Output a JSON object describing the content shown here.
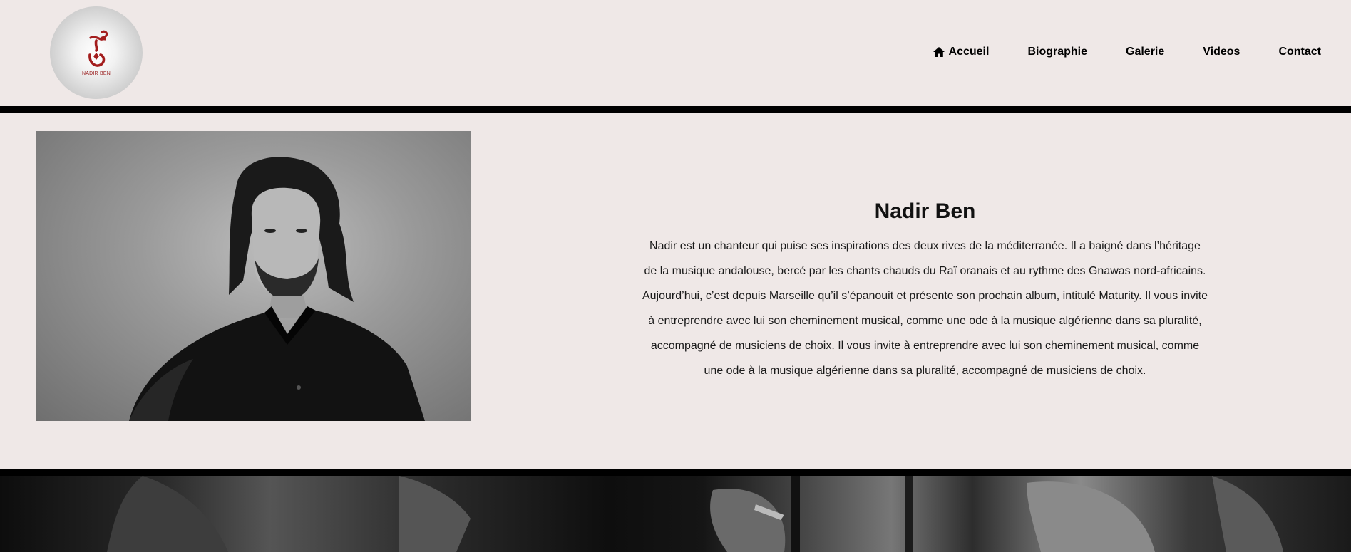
{
  "logo": {
    "text": "NADIR BEN",
    "icon": "nadir-ben-calligraphy-logo",
    "accent": "#a31d1d"
  },
  "nav": {
    "items": [
      {
        "label": "Accueil",
        "icon": "home-icon"
      },
      {
        "label": "Biographie"
      },
      {
        "label": "Galerie"
      },
      {
        "label": "Videos"
      },
      {
        "label": "Contact"
      }
    ]
  },
  "bio": {
    "title": "Nadir Ben",
    "text": "Nadir est un chanteur qui puise ses inspirations des deux rives de la méditerranée. Il a baigné dans l’héritage de la musique andalouse, bercé par les chants chauds du Raï oranais et au rythme des Gnawas nord-africains. Aujourd’hui, c’est depuis Marseille qu’il s’épanouit et présente son prochain album, intitulé Maturity. Il vous invite à entreprendre avec lui son cheminement musical, comme une ode à la musique algérienne dans sa pluralité, accompagné de musiciens de choix. Il vous invite à entreprendre avec lui son cheminement musical, comme une ode à la musique algérienne dans sa pluralité, accompagné de musiciens de choix."
  },
  "colors": {
    "background": "#efe8e7",
    "bar": "#000000",
    "text": "#111111"
  }
}
